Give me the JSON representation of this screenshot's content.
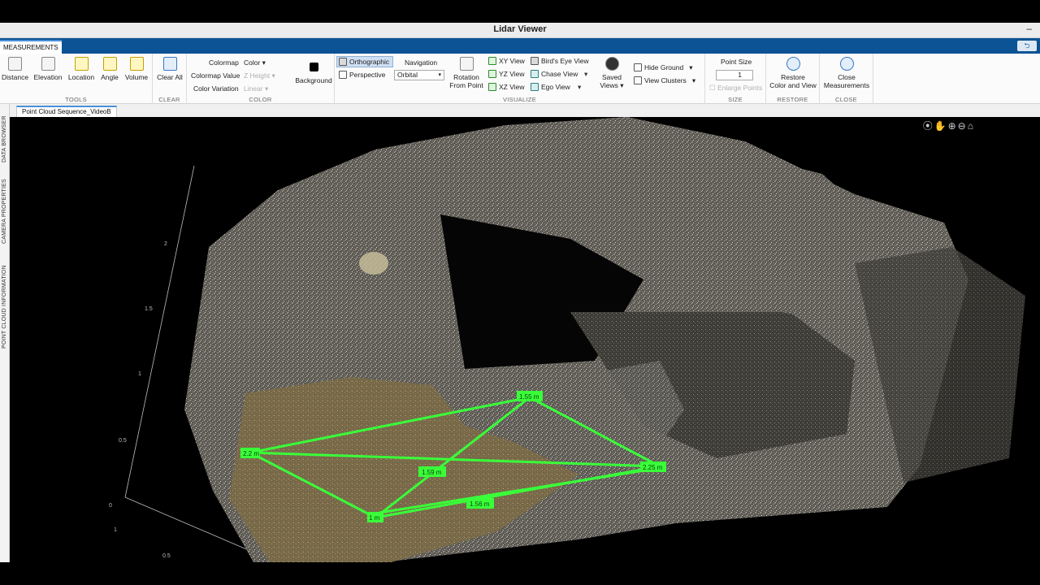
{
  "window": {
    "title": "Lidar Viewer",
    "minimize": "–"
  },
  "ribbon_tab": {
    "label": "MEASUREMENTS",
    "right_button": "⮌"
  },
  "tools": {
    "label": "TOOLS",
    "items": [
      "Distance",
      "Elevation",
      "Location",
      "Angle",
      "Volume"
    ]
  },
  "clear": {
    "label": "CLEAR",
    "button": "Clear All"
  },
  "color": {
    "label": "COLOR",
    "colormap_label": "Colormap",
    "colormap_value": "Color",
    "colormap_value_label": "Colormap Value",
    "colormap_value_value": "Z Height",
    "color_variation_label": "Color Variation",
    "color_variation_value": "Linear",
    "background": "Background"
  },
  "visualize": {
    "label": "VISUALIZE",
    "orthographic": "Orthographic",
    "perspective": "Perspective",
    "navigation_label": "Navigation",
    "navigation_value": "Orbital",
    "rotation": "Rotation",
    "from_point": "From Point",
    "xy_view": "XY View",
    "yz_view": "YZ View",
    "xz_view": "XZ View",
    "birds_eye": "Bird's Eye View",
    "chase": "Chase View",
    "ego": "Ego View",
    "saved": "Saved",
    "views": "Views",
    "hide_ground": "Hide Ground",
    "view_clusters": "View Clusters"
  },
  "size": {
    "label": "SIZE",
    "point_size_label": "Point Size",
    "point_size_value": "1",
    "enlarge": "Enlarge Points"
  },
  "restore": {
    "label": "RESTORE",
    "line1": "Restore",
    "line2": "Color and View"
  },
  "close": {
    "label": "CLOSE",
    "line1": "Close",
    "line2": "Measurements"
  },
  "document_tab": "Point Cloud Sequence_VideoB",
  "side_tabs": [
    "DATA BROWSER",
    "CAMERA PROPERTIES",
    "POINT CLOUD INFORMATION"
  ],
  "viewport_tools": "⦿✋⊕⊖⌂",
  "axis_ticks": [
    "2",
    "1.5",
    "1",
    "0.5",
    "0",
    "1",
    "0.5",
    "0"
  ],
  "measurements": [
    "2.2 m",
    "1.55 m",
    "1.59 m",
    "2.25 m",
    "1.56 m",
    "1 m"
  ],
  "colors": {
    "measure_line": "#39ff39",
    "ribbon_blue": "#0b5394"
  }
}
